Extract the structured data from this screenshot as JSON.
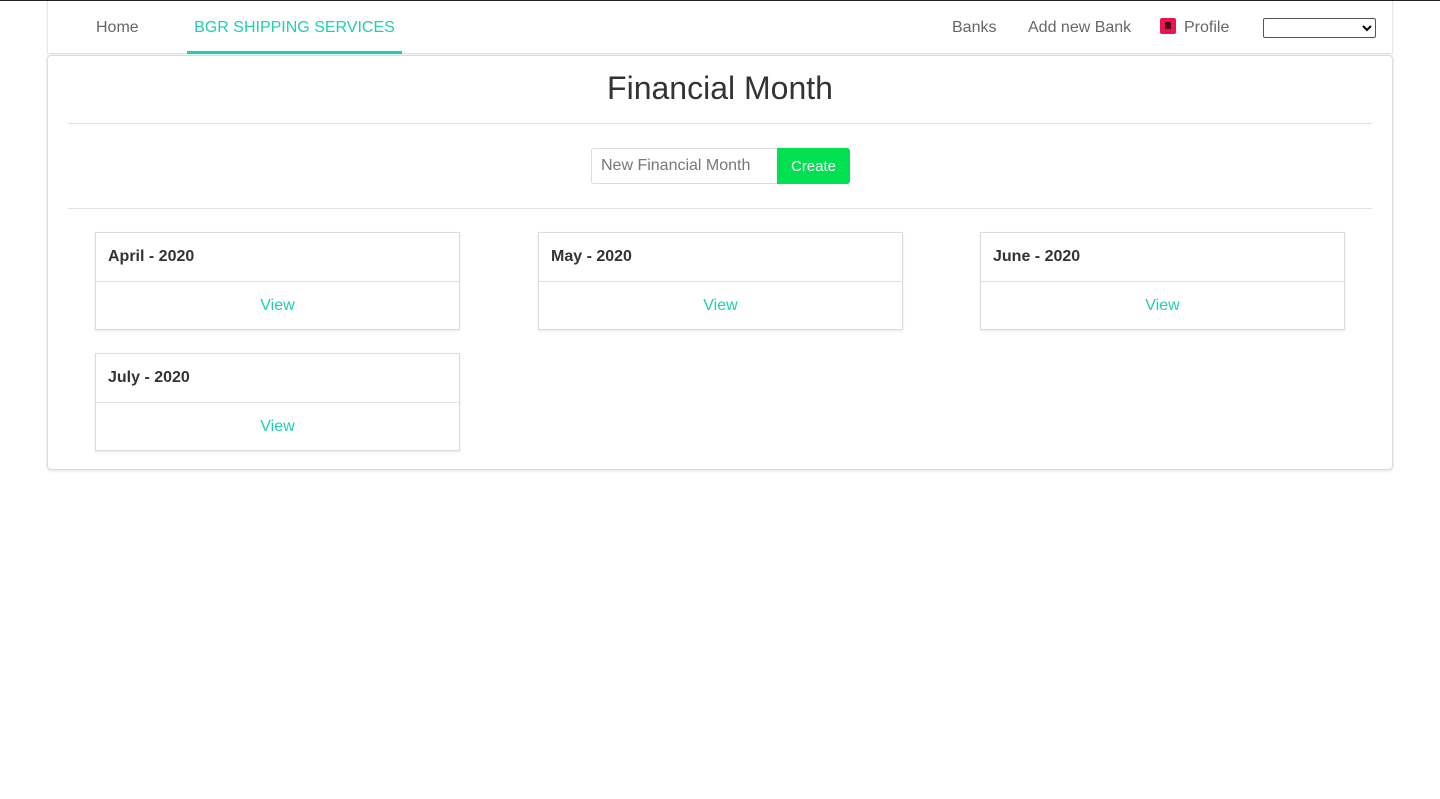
{
  "navbar": {
    "home_label": "Home",
    "brand_label": "BGR SHIPPING SERVICES",
    "banks_label": "Banks",
    "add_bank_label": "Add new Bank",
    "profile_label": "Profile",
    "profile_icon": "profile-avatar-icon",
    "select_value": ""
  },
  "main": {
    "title": "Financial Month",
    "form": {
      "input_placeholder": "New Financial Month",
      "input_value": "",
      "create_label": "Create"
    },
    "months": [
      {
        "title": "April - 2020",
        "action": "View"
      },
      {
        "title": "May - 2020",
        "action": "View"
      },
      {
        "title": "June - 2020",
        "action": "View"
      },
      {
        "title": "July - 2020",
        "action": "View"
      }
    ]
  },
  "colors": {
    "accent": "#1fcfb0",
    "create_button": "#00e050",
    "profile_icon": "#e8154e"
  }
}
